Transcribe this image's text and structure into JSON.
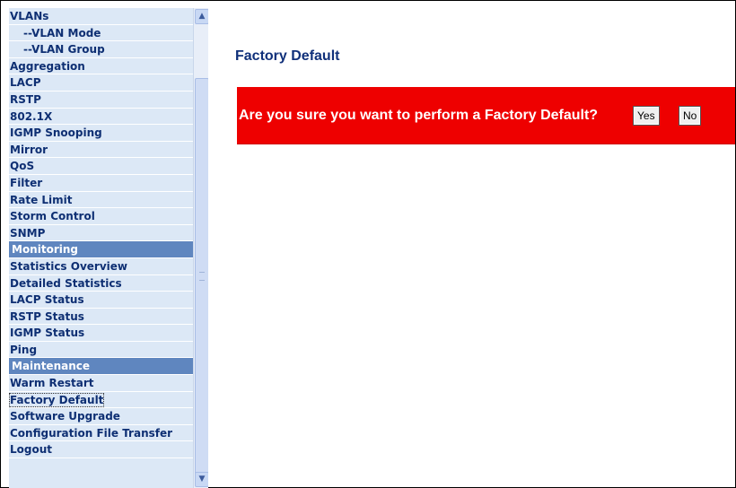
{
  "sidebar": {
    "items": [
      {
        "label": "VLANs",
        "type": "item"
      },
      {
        "label": "--VLAN Mode",
        "type": "sub"
      },
      {
        "label": "--VLAN Group",
        "type": "sub"
      },
      {
        "label": "Aggregation",
        "type": "item"
      },
      {
        "label": "LACP",
        "type": "item"
      },
      {
        "label": "RSTP",
        "type": "item"
      },
      {
        "label": "802.1X",
        "type": "item"
      },
      {
        "label": "IGMP Snooping",
        "type": "item"
      },
      {
        "label": "Mirror",
        "type": "item"
      },
      {
        "label": "QoS",
        "type": "item"
      },
      {
        "label": "Filter",
        "type": "item"
      },
      {
        "label": "Rate Limit",
        "type": "item"
      },
      {
        "label": "Storm Control",
        "type": "item"
      },
      {
        "label": "SNMP",
        "type": "item"
      },
      {
        "label": "Monitoring",
        "type": "header"
      },
      {
        "label": "Statistics Overview",
        "type": "item"
      },
      {
        "label": "Detailed Statistics",
        "type": "item"
      },
      {
        "label": "LACP Status",
        "type": "item"
      },
      {
        "label": "RSTP Status",
        "type": "item"
      },
      {
        "label": "IGMP Status",
        "type": "item"
      },
      {
        "label": "Ping",
        "type": "item"
      },
      {
        "label": "Maintenance",
        "type": "header"
      },
      {
        "label": "Warm Restart",
        "type": "item"
      },
      {
        "label": "Factory Default",
        "type": "item",
        "active": true
      },
      {
        "label": "Software Upgrade",
        "type": "item"
      },
      {
        "label": "Configuration File Transfer",
        "type": "item"
      },
      {
        "label": "Logout",
        "type": "item"
      }
    ],
    "scroll_up_icon": "▲",
    "scroll_down_icon": "▼"
  },
  "main": {
    "title": "Factory Default",
    "confirm_message": "Are you sure you want to perform a Factory Default?",
    "yes_label": "Yes",
    "no_label": "No"
  },
  "colors": {
    "menu_text": "#0e2f73",
    "menu_bg": "#dce8f6",
    "section_header_bg": "#5f86bf",
    "confirm_bg": "#ee0000",
    "title": "#10307a"
  }
}
